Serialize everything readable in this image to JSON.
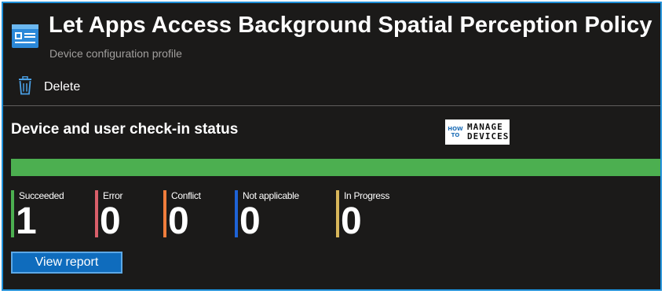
{
  "header": {
    "title": "Let Apps Access Background Spatial Perception Policy",
    "subtitle": "Device configuration profile"
  },
  "toolbar": {
    "delete_label": "Delete",
    "delete_icon": "trash-icon"
  },
  "status": {
    "section_title": "Device and user check-in status",
    "progress_fraction": 1.0,
    "items": [
      {
        "label": "Succeeded",
        "value": "1",
        "color": "#4caf50"
      },
      {
        "label": "Error",
        "value": "0",
        "color": "#d95f6a"
      },
      {
        "label": "Conflict",
        "value": "0",
        "color": "#f07d3c"
      },
      {
        "label": "Not applicable",
        "value": "0",
        "color": "#1e63d6"
      },
      {
        "label": "In Progress",
        "value": "0",
        "color": "#d8b65a"
      }
    ],
    "view_report_label": "View report"
  },
  "watermark": {
    "left_lines": [
      "HOW",
      "TO"
    ],
    "right_lines": [
      "MANAGE",
      "DEVICES"
    ]
  },
  "colors": {
    "background": "#1b1a19",
    "frame_border": "#1e8fd8",
    "progress_fill": "#4caf50",
    "button": "#0f6cbd"
  }
}
